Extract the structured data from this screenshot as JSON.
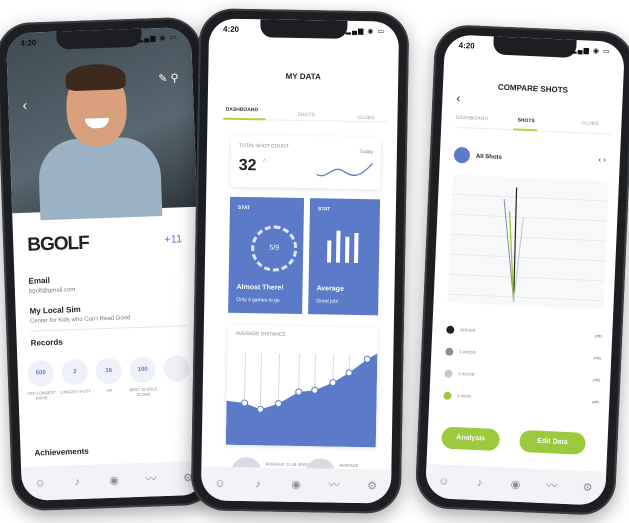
{
  "status": {
    "time": "4:20"
  },
  "profile": {
    "username": "BGOLF",
    "badge": "+11",
    "email_label": "Email",
    "email_value": "bgolf@gmail.com",
    "sim_label": "My Local Sim",
    "sim_value": "Center for Kids who Can't Read Good",
    "records_label": "Records",
    "records": [
      {
        "value": "500",
        "label": "YRD LONGEST DRIVE"
      },
      {
        "value": "3",
        "label": "LONGEST PUTT"
      },
      {
        "value": "16",
        "label": "HP"
      },
      {
        "value": "100",
        "label": "BEST 18 HOLE SCORE"
      }
    ],
    "achievements_label": "Achievements"
  },
  "mydata": {
    "title": "MY DATA",
    "tabs": [
      "DASHBOARD",
      "SHOTS",
      "CLUBS"
    ],
    "shot_count_label": "TOTAL SHOT COUNT",
    "shot_count": "32",
    "period": "Today",
    "stat1": {
      "head": "STAT",
      "center": "5/9",
      "title": "Almost There!",
      "sub": "Only 4 games to go"
    },
    "stat2": {
      "head": "STAT",
      "title": "Average",
      "sub": "Great job!"
    },
    "avg_label": "AVERAGE DISTANCE",
    "g1": "AVERAGE CLUB SPEED",
    "g2": "AVERAGE DISTANCE"
  },
  "compare": {
    "title": "COMPARE SHOTS",
    "tabs": [
      "DASHBOARD",
      "SHOTS",
      "CLUBS"
    ],
    "filter_label": "All Shots",
    "legend": [
      {
        "name": "DRIVER",
        "color": "#222222",
        "unit": "yrds"
      },
      {
        "name": "3 WOOD",
        "color": "#8a8f99",
        "unit": "yrds"
      },
      {
        "name": "5 WOOD",
        "color": "#c4c7cc",
        "unit": "yrds"
      },
      {
        "name": "3 IRON",
        "color": "#9cc93d",
        "unit": "yrds"
      }
    ],
    "btn_analysis": "Analysis",
    "btn_edit": "Edit Data"
  },
  "colors": {
    "accent": "#5b7bc9",
    "green": "#9cc93d"
  }
}
